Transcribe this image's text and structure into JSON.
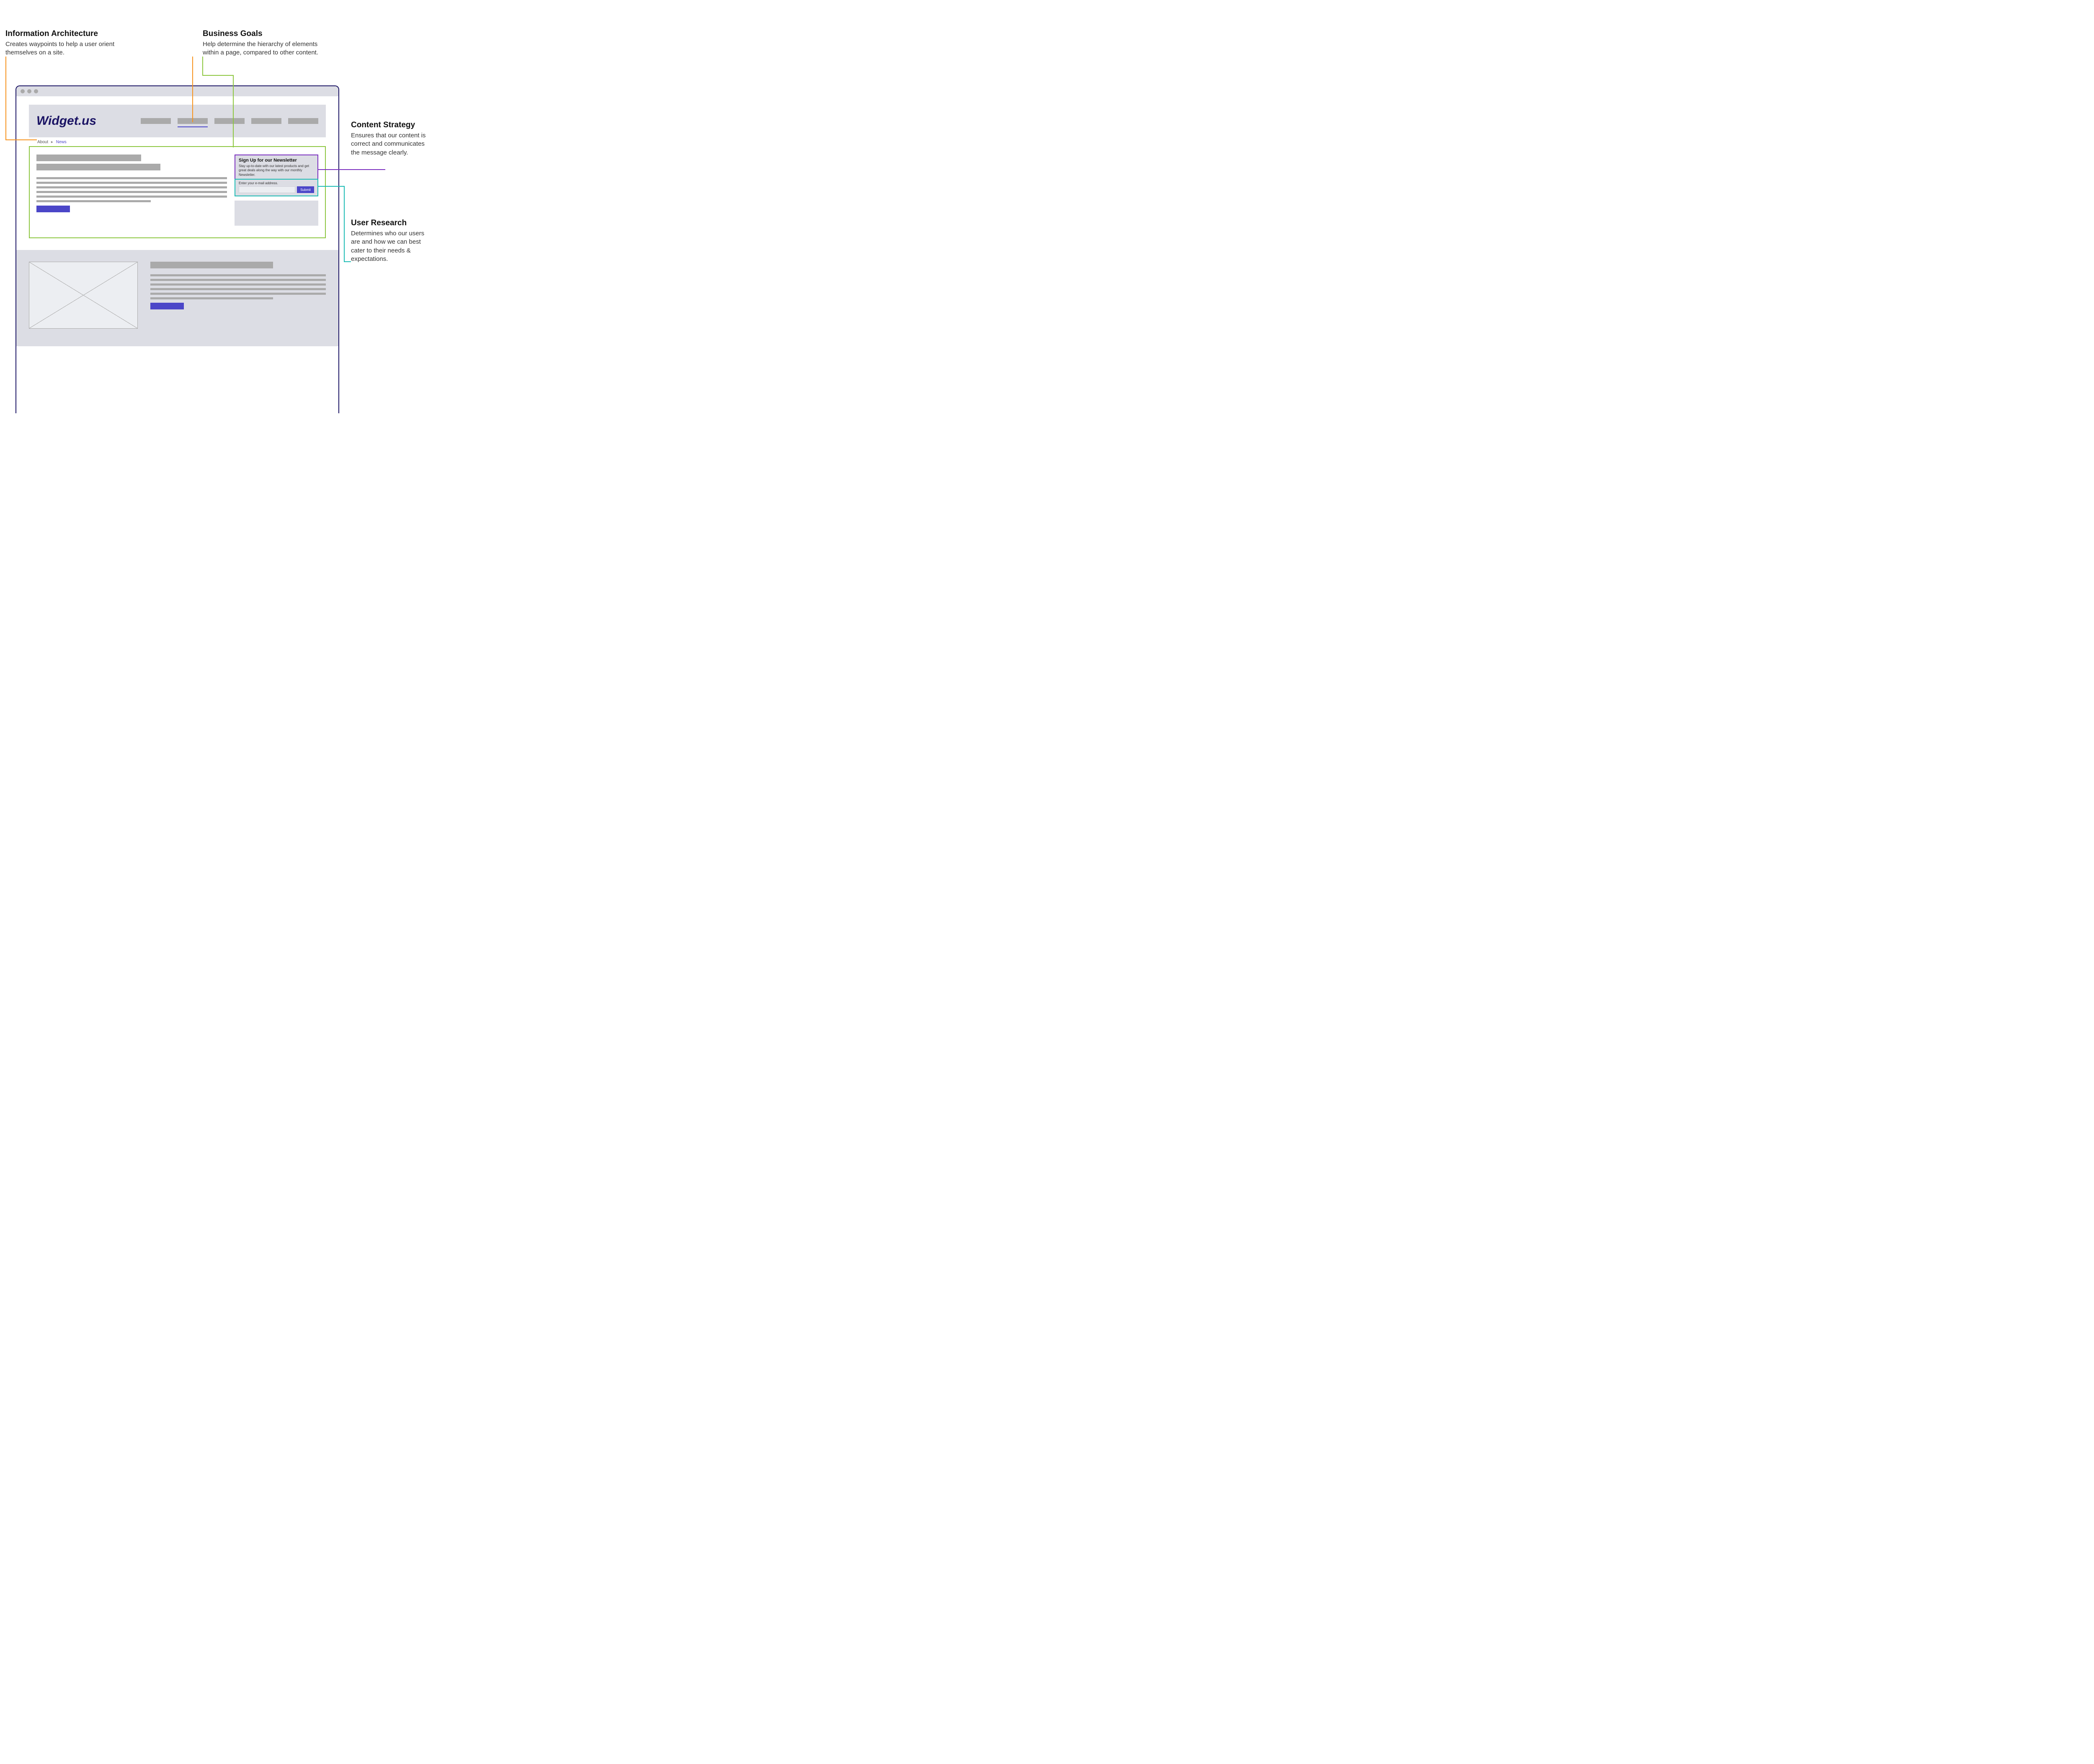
{
  "annotations": {
    "ia": {
      "title": "Information Architecture",
      "body": "Creates waypoints to help a user orient themselves on a site."
    },
    "biz": {
      "title": "Business Goals",
      "body": "Help determine the hierarchy of elements within a page, compared to other content."
    },
    "content": {
      "title": "Content Strategy",
      "body": "Ensures that our content is correct and communicates the message clearly."
    },
    "research": {
      "title": "User Research",
      "body": "Determines who our users are and how we can best cater to their needs & expectations."
    }
  },
  "site": {
    "logo": "Widget.us",
    "breadcrumb": {
      "root": "About",
      "current": "News"
    }
  },
  "newsletter": {
    "heading": "Sign Up for our Newsletter",
    "blurb": "Stay up-to-date with our latest products and get great deals along the way with our monthly Newsletter.",
    "input_label": "Enter your e-mail address.",
    "submit": "Submit"
  },
  "colors": {
    "ia": "#f7931e",
    "biz": "#8cc63f",
    "content": "#7b2fbf",
    "research": "#1cbbb4",
    "brand": "#1b1464",
    "accent": "#4b46c8"
  }
}
